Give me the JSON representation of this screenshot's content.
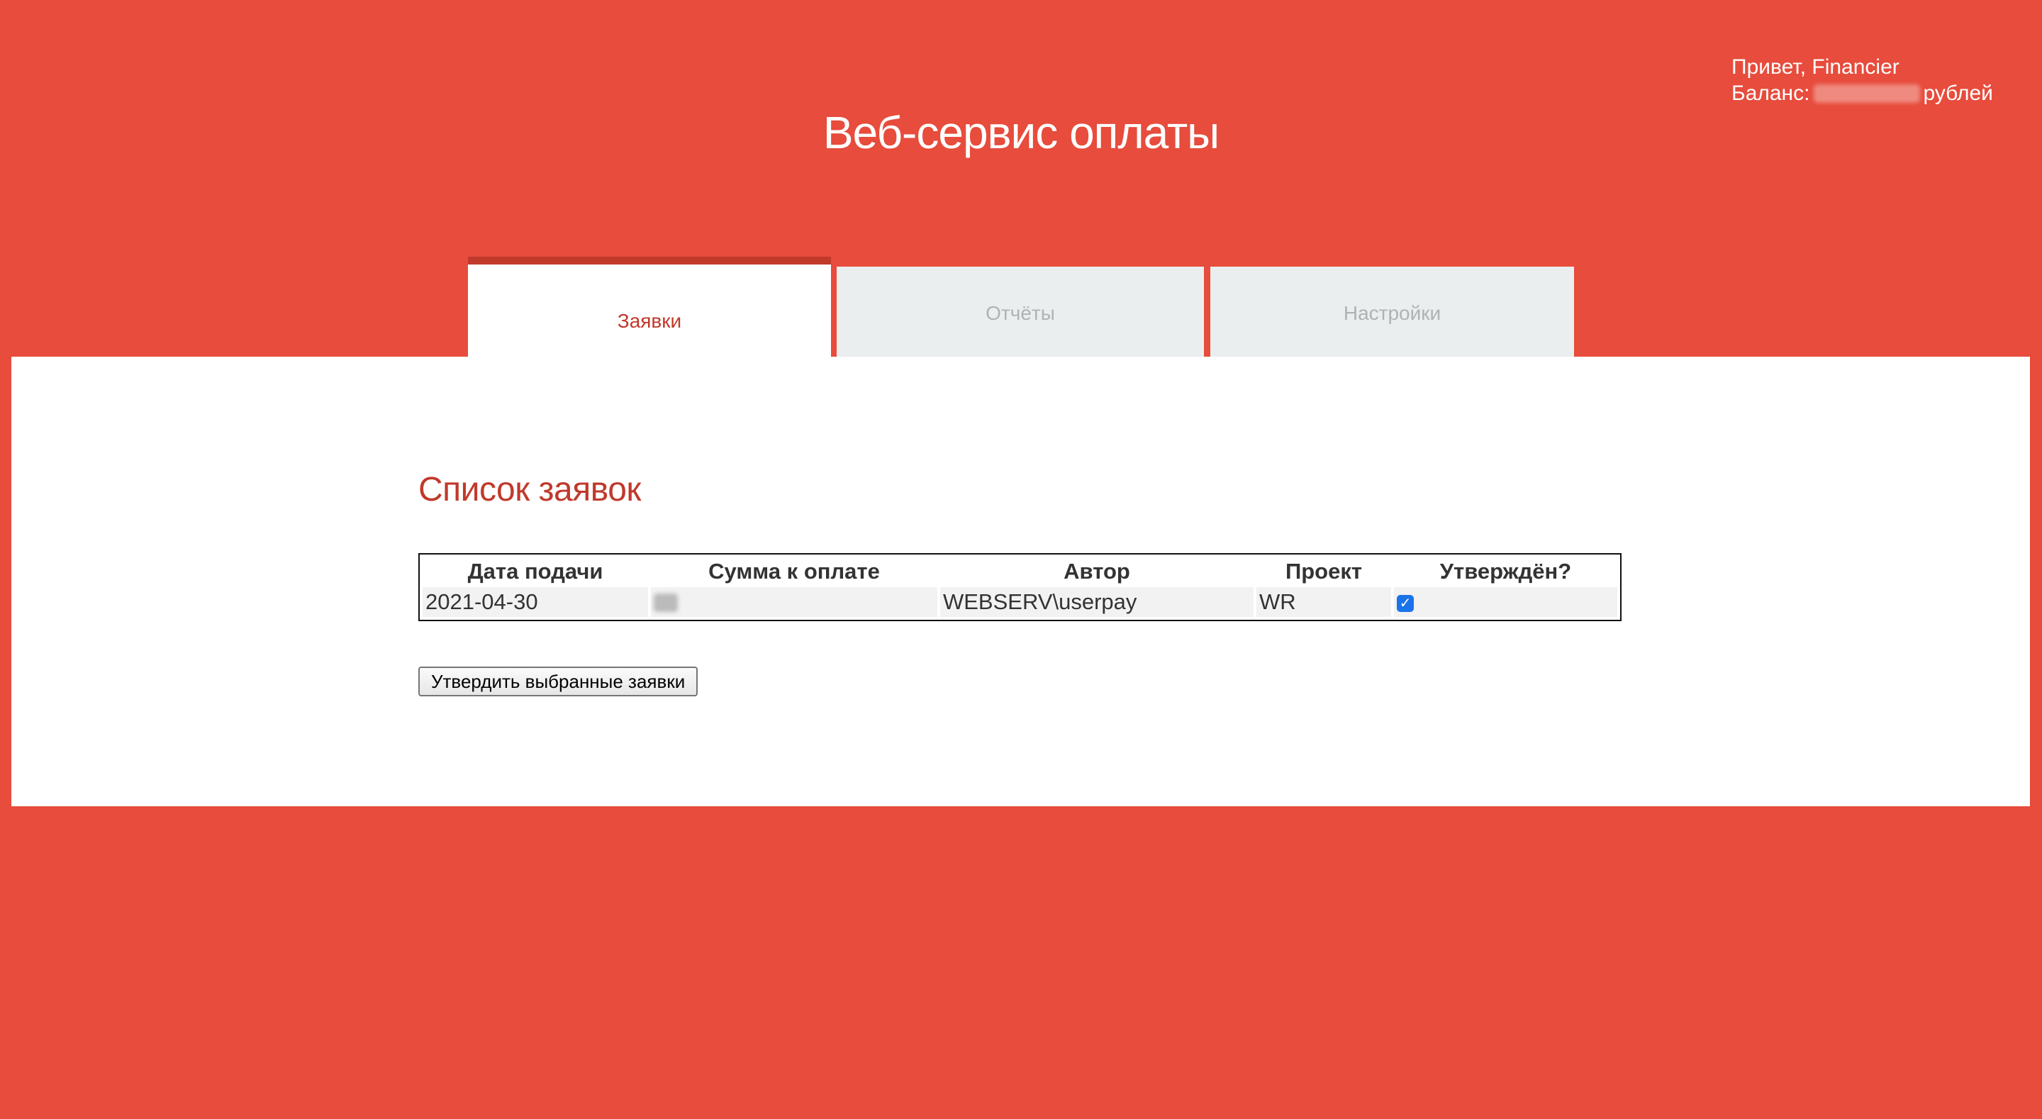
{
  "header": {
    "title": "Веб-сервис оплаты",
    "greeting": "Привет, Financier",
    "balance_label": "Баланс:",
    "balance_unit": "рублей"
  },
  "tabs": [
    {
      "label": "Заявки",
      "active": true
    },
    {
      "label": "Отчёты",
      "active": false
    },
    {
      "label": "Настройки",
      "active": false
    }
  ],
  "main": {
    "section_title": "Список заявок",
    "table": {
      "columns": [
        "Дата подачи",
        "Сумма к оплате",
        "Автор",
        "Проект",
        "Утверждён?"
      ],
      "rows": [
        {
          "date": "2021-04-30",
          "author": "WEBSERV\\userpay",
          "project": "WR",
          "approved": true
        }
      ]
    },
    "approve_button_label": "Утвердить выбранные заявки"
  },
  "colors": {
    "background": "#e74c3c",
    "accent": "#c0392b",
    "inactive_tab": "#ebeeee",
    "checkbox": "#1a73e8"
  }
}
